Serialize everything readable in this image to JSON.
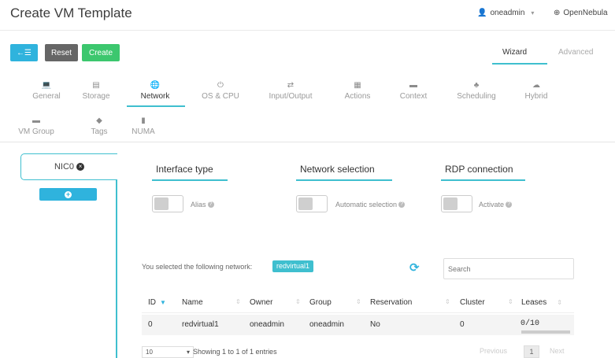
{
  "header": {
    "title": "Create VM Template",
    "user": "oneadmin",
    "zone": "OpenNebula"
  },
  "toolbar": {
    "back_icon": "←☰",
    "reset_label": "Reset",
    "create_label": "Create",
    "wizard_label": "Wizard",
    "advanced_label": "Advanced"
  },
  "tabs": [
    {
      "label": "General",
      "icon": "laptop-icon",
      "glyph": "💻"
    },
    {
      "label": "Storage",
      "icon": "hdd-icon",
      "glyph": "▤"
    },
    {
      "label": "Network",
      "icon": "globe-icon",
      "glyph": "🌐"
    },
    {
      "label": "OS & CPU",
      "icon": "power-icon",
      "glyph": "⏻"
    },
    {
      "label": "Input/Output",
      "icon": "exchange-icon",
      "glyph": "⇄"
    },
    {
      "label": "Actions",
      "icon": "calendar-icon",
      "glyph": "▦"
    },
    {
      "label": "Context",
      "icon": "folder-icon",
      "glyph": "▬"
    },
    {
      "label": "Scheduling",
      "icon": "sitemap-icon",
      "glyph": "♣"
    },
    {
      "label": "Hybrid",
      "icon": "cloud-icon",
      "glyph": "☁"
    },
    {
      "label": "VM Group",
      "icon": "folder-icon",
      "glyph": "▬"
    },
    {
      "label": "Tags",
      "icon": "tag-icon",
      "glyph": "◆"
    },
    {
      "label": "NUMA",
      "icon": "microchip-icon",
      "glyph": "▮"
    }
  ],
  "nic": {
    "tab_label": "NIC0",
    "add_label": "+"
  },
  "sections": {
    "interface_type": "Interface type",
    "network_selection": "Network selection",
    "rdp_connection": "RDP connection"
  },
  "toggles": {
    "alias": "Alias",
    "automatic_selection": "Automatic selection",
    "activate": "Activate"
  },
  "selection": {
    "text": "You selected the following network:",
    "network": "redvirtual1"
  },
  "search": {
    "placeholder": "Search"
  },
  "table": {
    "columns": [
      "ID",
      "Name",
      "Owner",
      "Group",
      "Reservation",
      "Cluster",
      "Leases"
    ],
    "rows": [
      {
        "id": "0",
        "name": "redvirtual1",
        "owner": "oneadmin",
        "group": "oneadmin",
        "reservation": "No",
        "cluster": "0",
        "leases": "0/10"
      }
    ]
  },
  "footer": {
    "page_length": "10",
    "info": "Showing 1 to 1 of 1 entries",
    "previous": "Previous",
    "page": "1",
    "next": "Next"
  },
  "colors": {
    "accent": "#3fbfcf",
    "primary": "#2fb3dd",
    "create": "#3cc76e",
    "reset": "#666666"
  }
}
